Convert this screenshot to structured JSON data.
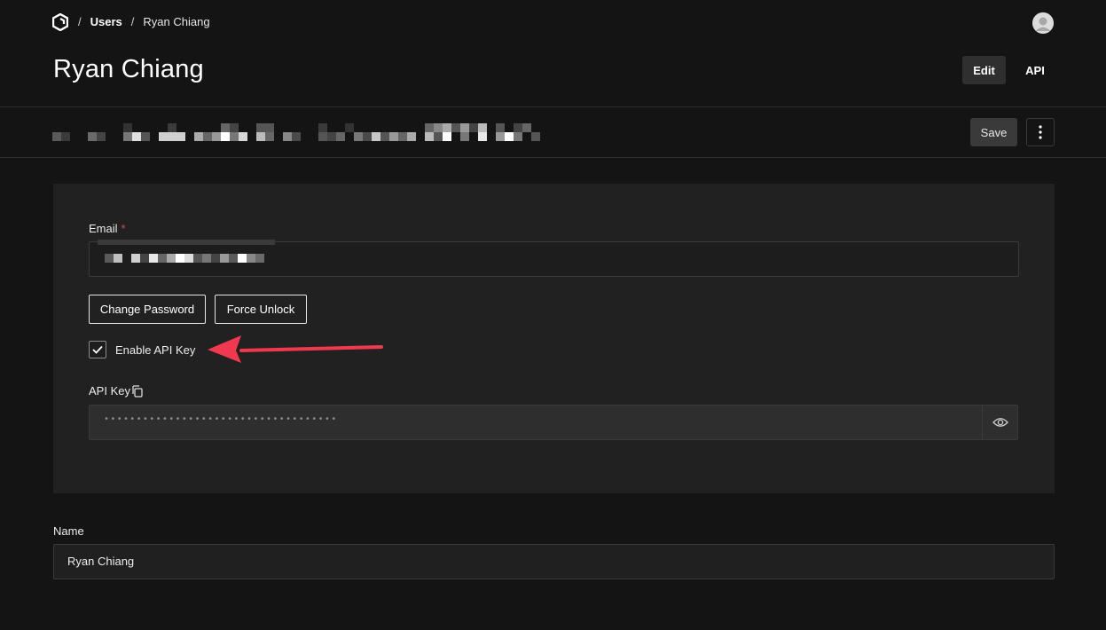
{
  "breadcrumb": {
    "separator": "/",
    "users": "Users",
    "current": "Ryan Chiang"
  },
  "page": {
    "title": "Ryan Chiang",
    "tab_edit": "Edit",
    "tab_api": "API"
  },
  "toolbar": {
    "save_label": "Save"
  },
  "form": {
    "email_label": "Email",
    "email_required_marker": "*",
    "change_password_label": "Change Password",
    "force_unlock_label": "Force Unlock",
    "enable_api_key_label": "Enable API Key",
    "enable_api_key_checked": true,
    "api_key_label": "API Key",
    "api_key_masked": "••••••••••••••••••••••••••••••••••••",
    "name_label": "Name",
    "name_value": "Ryan Chiang"
  },
  "icons": {
    "logo": "logo-icon",
    "avatar": "avatar",
    "more": "kebab-menu-icon",
    "checkbox": "checkmark-icon",
    "copy": "copy-icon",
    "reveal": "eye-icon",
    "annotation": "red-arrow-annotation"
  },
  "colors": {
    "background": "#141414",
    "panel": "#212121",
    "required_marker": "#e0465a",
    "annotation_arrow": "#f0394f"
  }
}
